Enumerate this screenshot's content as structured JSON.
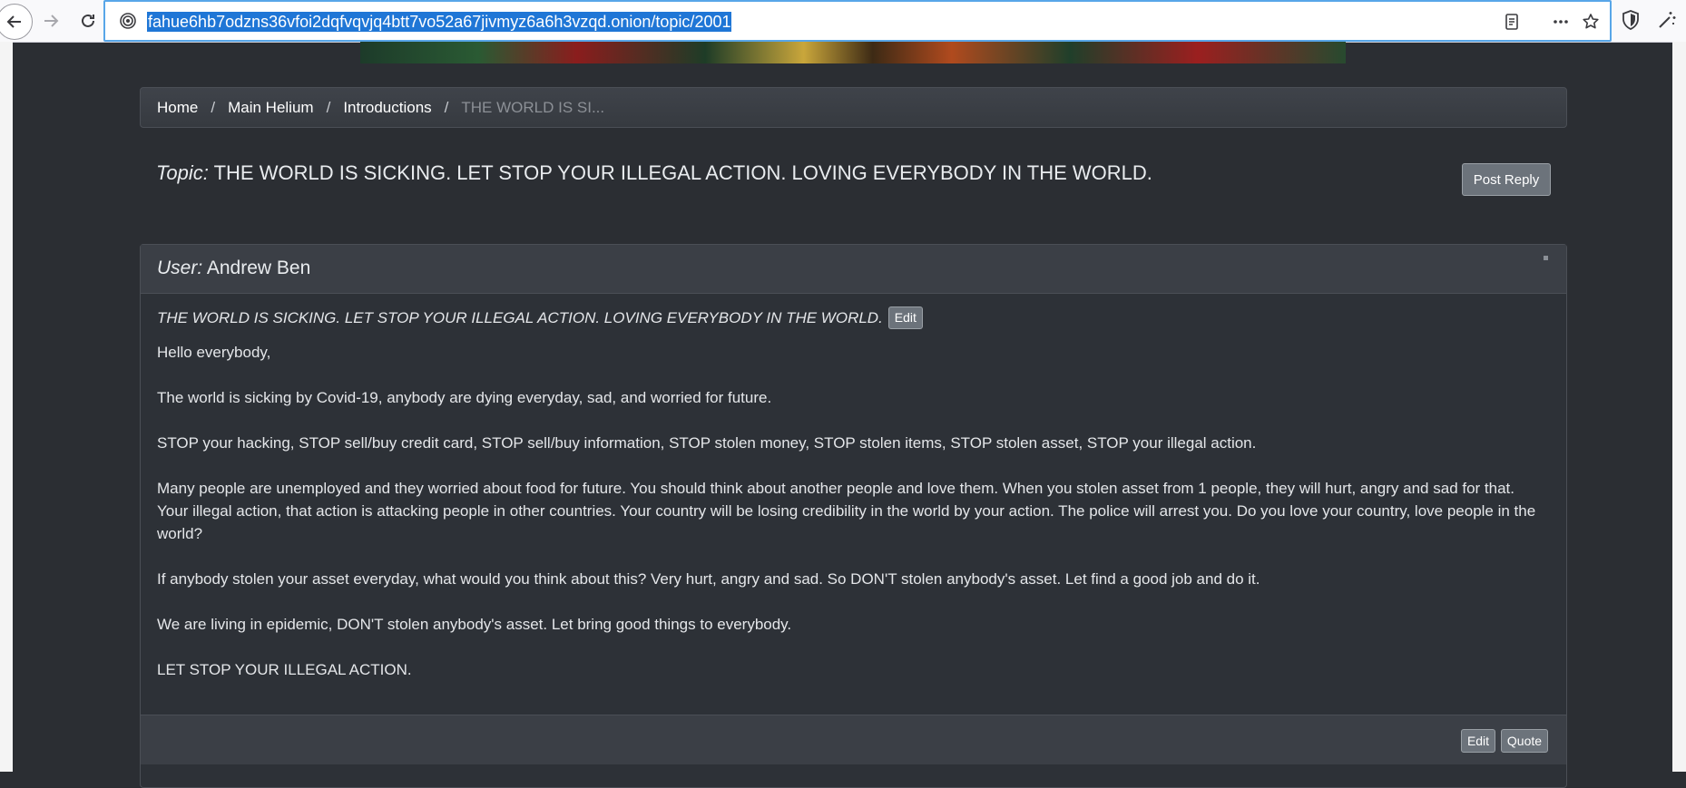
{
  "browser": {
    "url": "fahue6hb7odzns36vfoi2dqfvqvjq4btt7vo52a67jivmyz6a6h3vzqd.onion/topic/2001"
  },
  "breadcrumb": {
    "items": [
      "Home",
      "Main Helium",
      "Introductions"
    ],
    "separator": "/",
    "active": "THE WORLD IS SI..."
  },
  "topic": {
    "label": "Topic:",
    "title": "THE WORLD IS SICKING. LET STOP YOUR ILLEGAL ACTION. LOVING EVERYBODY IN THE WORLD.",
    "post_reply_label": "Post Reply"
  },
  "post": {
    "user_label": "User:",
    "user_name": "Andrew Ben",
    "subject": "THE WORLD IS SICKING. LET STOP YOUR ILLEGAL ACTION. LOVING EVERYBODY IN THE WORLD.",
    "edit_label": "Edit",
    "paragraphs": [
      "Hello everybody,",
      "The world is sicking by Covid-19, anybody are dying everyday, sad, and worried for future.",
      "STOP your hacking, STOP sell/buy credit card, STOP sell/buy information, STOP stolen money, STOP stolen items, STOP stolen asset, STOP your illegal action.",
      "Many people are unemployed and they worried about food for future. You should think about another people and love them. When you stolen asset from 1 people, they will hurt, angry and sad for that. Your illegal action, that action is attacking people in other countries. Your country will be losing credibility in the world by your action. The police will arrest you. Do you love your country, love people in the world?",
      "If anybody stolen your asset everyday, what would you think about this? Very hurt, angry and sad. So DON'T stolen anybody's asset. Let find a good job and do it.",
      "We are living in epidemic, DON'T stolen anybody's asset. Let bring good things to everybody.",
      "LET STOP YOUR ILLEGAL ACTION."
    ],
    "footer": {
      "edit_label": "Edit",
      "quote_label": "Quote"
    }
  }
}
